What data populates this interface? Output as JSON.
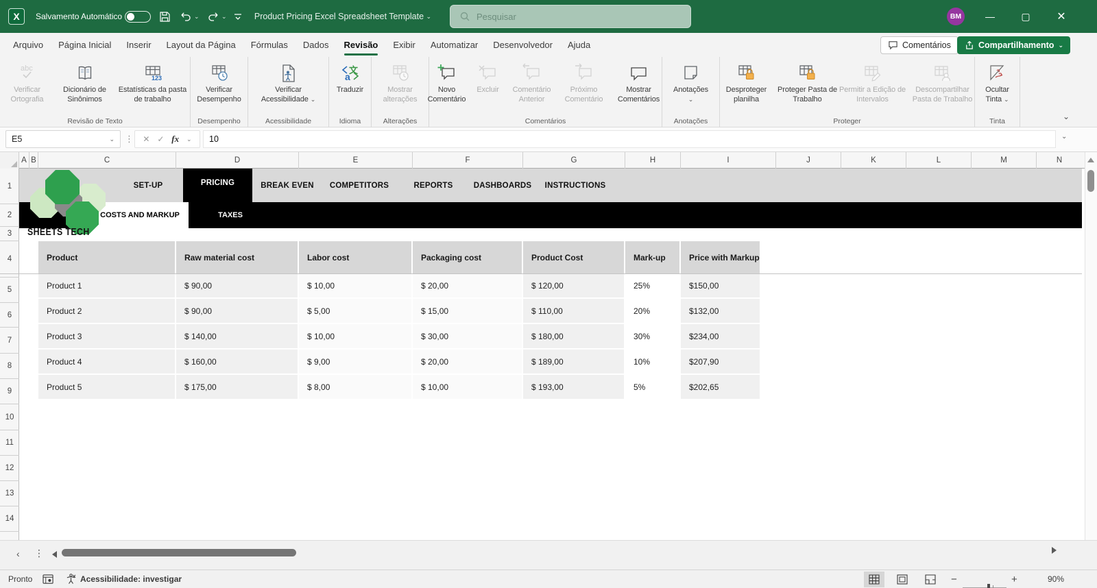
{
  "titlebar": {
    "autosave_label": "Salvamento Automático",
    "title": "Product Pricing Excel Spreadsheet Template",
    "search_placeholder": "Pesquisar",
    "avatar_initials": "BM"
  },
  "menubar": {
    "tabs": [
      {
        "label": "Arquivo"
      },
      {
        "label": "Página Inicial"
      },
      {
        "label": "Inserir"
      },
      {
        "label": "Layout da Página"
      },
      {
        "label": "Fórmulas"
      },
      {
        "label": "Dados"
      },
      {
        "label": "Revisão",
        "active": true
      },
      {
        "label": "Exibir"
      },
      {
        "label": "Automatizar"
      },
      {
        "label": "Desenvolvedor"
      },
      {
        "label": "Ajuda"
      }
    ],
    "comments_button": "Comentários",
    "share_button": "Compartilhamento"
  },
  "ribbon": {
    "groups": [
      {
        "label": "Revisão de Texto",
        "buttons": [
          {
            "label": "Verificar Ortografia",
            "disabled": true
          },
          {
            "label": "Dicionário de Sinônimos"
          },
          {
            "label": "Estatísticas da pasta de trabalho"
          }
        ]
      },
      {
        "label": "Desempenho",
        "buttons": [
          {
            "label": "Verificar Desempenho"
          }
        ]
      },
      {
        "label": "Acessibilidade",
        "buttons": [
          {
            "label": "Verificar Acessibilidade"
          }
        ]
      },
      {
        "label": "Idioma",
        "buttons": [
          {
            "label": "Traduzir"
          }
        ]
      },
      {
        "label": "Alterações",
        "buttons": [
          {
            "label": "Mostrar alterações",
            "disabled": true
          }
        ]
      },
      {
        "label": "Comentários",
        "buttons": [
          {
            "label": "Novo Comentário"
          },
          {
            "label": "Excluir",
            "disabled": true
          },
          {
            "label": "Comentário Anterior",
            "disabled": true
          },
          {
            "label": "Próximo Comentário",
            "disabled": true
          },
          {
            "label": "Mostrar Comentários"
          }
        ]
      },
      {
        "label": "Anotações",
        "buttons": [
          {
            "label": "Anotações"
          }
        ]
      },
      {
        "label": "Proteger",
        "buttons": [
          {
            "label": "Desproteger planilha"
          },
          {
            "label": "Proteger Pasta de Trabalho"
          },
          {
            "label": "Permitir a Edição de Intervalos",
            "disabled": true
          },
          {
            "label": "Descompartilhar Pasta de Trabalho",
            "disabled": true
          }
        ]
      },
      {
        "label": "Tinta",
        "buttons": [
          {
            "label": "Ocultar Tinta"
          }
        ]
      }
    ]
  },
  "formula_bar": {
    "name_box": "E5",
    "fx_label": "fx",
    "value": "10"
  },
  "grid": {
    "columns": [
      "A",
      "B",
      "C",
      "D",
      "E",
      "F",
      "G",
      "H",
      "I",
      "J",
      "K",
      "L",
      "M",
      "N"
    ],
    "rows": [
      "1",
      "2",
      "3",
      "4",
      "5",
      "6",
      "7",
      "8",
      "9",
      "10",
      "11",
      "12",
      "13",
      "14"
    ]
  },
  "sheet": {
    "nav_tabs": [
      {
        "label": "SET-UP"
      },
      {
        "label": "PRICING",
        "active": true
      },
      {
        "label": "BREAK EVEN"
      },
      {
        "label": "COMPETITORS"
      },
      {
        "label": "REPORTS"
      },
      {
        "label": "DASHBOARDS"
      },
      {
        "label": "INSTRUCTIONS"
      }
    ],
    "sub_tabs": [
      {
        "label": "COSTS AND MARKUP",
        "active": true
      },
      {
        "label": "TAXES"
      }
    ],
    "logo_text": "SHEETS TECH",
    "table": {
      "headers": [
        "Product",
        "Raw material cost",
        "Labor cost",
        "Packaging cost",
        "Product Cost",
        "Mark-up",
        "Price with Markup"
      ],
      "rows": [
        [
          "Product 1",
          "$ 90,00",
          "$ 10,00",
          "$ 20,00",
          "$ 120,00",
          "25%",
          "$150,00"
        ],
        [
          "Product 2",
          "$ 90,00",
          "$ 5,00",
          "$ 15,00",
          "$ 110,00",
          "20%",
          "$132,00"
        ],
        [
          "Product 3",
          "$ 140,00",
          "$ 10,00",
          "$ 30,00",
          "$ 180,00",
          "30%",
          "$234,00"
        ],
        [
          "Product 4",
          "$ 160,00",
          "$ 9,00",
          "$ 20,00",
          "$ 189,00",
          "10%",
          "$207,90"
        ],
        [
          "Product 5",
          "$ 175,00",
          "$ 8,00",
          "$ 10,00",
          "$ 193,00",
          "5%",
          "$202,65"
        ]
      ]
    }
  },
  "statusbar": {
    "mode": "Pronto",
    "accessibility": "Acessibilidade: investigar",
    "zoom_level": "90%"
  },
  "colors": {
    "titlebar_green": "#1e6b41",
    "accent_green": "#1e7145",
    "share_green": "#187a45",
    "lock_orange": "#f3b04b",
    "ink_red": "#c0504d",
    "avatar_purple": "#9636a0"
  }
}
